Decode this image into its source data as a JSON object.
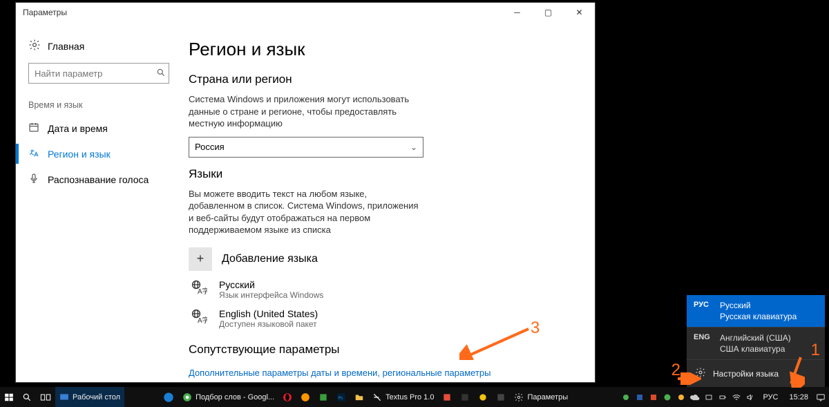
{
  "window": {
    "title": "Параметры",
    "home_label": "Главная",
    "search_placeholder": "Найти параметр",
    "group_label": "Время и язык",
    "nav": [
      {
        "label": "Дата и время"
      },
      {
        "label": "Регион и язык"
      },
      {
        "label": "Распознавание голоса"
      }
    ]
  },
  "content": {
    "heading": "Регион и язык",
    "sec_region_title": "Страна или регион",
    "sec_region_desc": "Система Windows и приложения могут использовать данные о стране и регионе, чтобы предоставлять местную информацию",
    "region_value": "Россия",
    "sec_lang_title": "Языки",
    "sec_lang_desc": "Вы можете вводить текст на любом языке, добавленном в список. Система Windows, приложения и веб-сайты будут отображаться на первом поддерживаемом языке из списка",
    "add_lang_label": "Добавление языка",
    "languages": [
      {
        "name": "Русский",
        "sub": "Язык интерфейса Windows"
      },
      {
        "name": "English (United States)",
        "sub": "Доступен языковой пакет"
      }
    ],
    "sec_related_title": "Сопутствующие параметры",
    "related_link": "Дополнительные параметры даты и времени, региональные параметры"
  },
  "lang_popup": {
    "rows": [
      {
        "code": "РУС",
        "name": "Русский",
        "sub": "Русская клавиатура"
      },
      {
        "code": "ENG",
        "name": "Английский (США)",
        "sub": "США клавиатура"
      }
    ],
    "settings_label": "Настройки языка"
  },
  "taskbar": {
    "pinned": [
      {
        "label": "Рабочий стол"
      }
    ],
    "tasks": [
      {
        "label": "Подбор слов - Googl..."
      },
      {
        "label": "Textus Pro 1.0"
      },
      {
        "label": "Параметры"
      }
    ],
    "lang_indicator": "РУС",
    "clock": "15:28"
  },
  "annotations": {
    "n1": "1",
    "n2": "2",
    "n3": "3"
  }
}
